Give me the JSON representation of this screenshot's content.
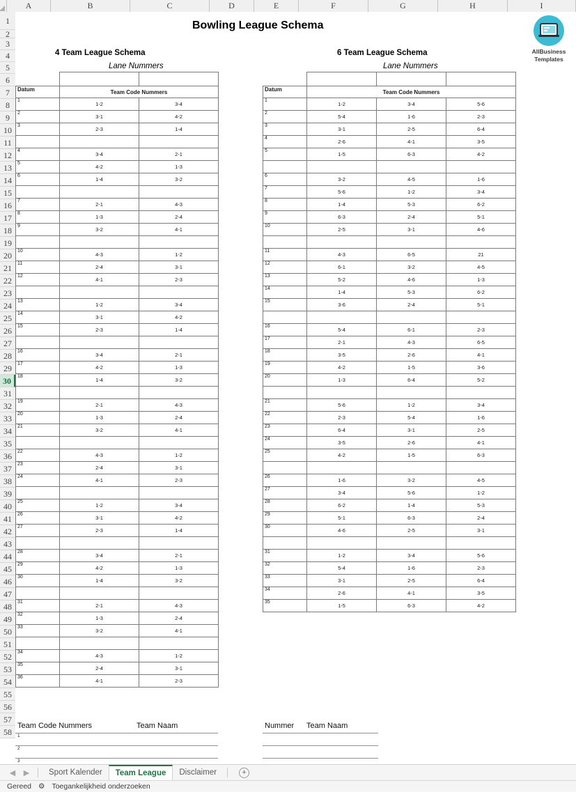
{
  "app": {
    "column_headers": [
      "A",
      "B",
      "C",
      "D",
      "E",
      "F",
      "G",
      "H",
      "I"
    ],
    "selected_cell_row": 30
  },
  "logo": {
    "name": "allbusiness-templates-logo",
    "line1": "AllBusiness",
    "line2": "Templates",
    "accent_color": "#3bbcd4",
    "icon": "laptop-icon"
  },
  "titles": {
    "document_title": "Bowling League Schema",
    "schema4_title": "4 Team League Schema",
    "schema6_title": "6 Team League Schema",
    "lane_label_left": "Lane Nummers",
    "lane_label_right": "Lane Nummers"
  },
  "headers": {
    "datum": "Datum",
    "team_code_nummers": "Team Code Nummers"
  },
  "schema4": {
    "rows": [
      {
        "datum": "1",
        "matches": [
          "1-2",
          "3-4"
        ]
      },
      {
        "datum": "2",
        "matches": [
          "3-1",
          "4-2"
        ]
      },
      {
        "datum": "3",
        "matches": [
          "2-3",
          "1-4"
        ]
      },
      {
        "datum": "",
        "matches": [
          "",
          ""
        ]
      },
      {
        "datum": "4",
        "matches": [
          "3-4",
          "2-1"
        ]
      },
      {
        "datum": "5",
        "matches": [
          "4-2",
          "1-3"
        ]
      },
      {
        "datum": "6",
        "matches": [
          "1-4",
          "3-2"
        ]
      },
      {
        "datum": "",
        "matches": [
          "",
          ""
        ]
      },
      {
        "datum": "7",
        "matches": [
          "2-1",
          "4-3"
        ]
      },
      {
        "datum": "8",
        "matches": [
          "1-3",
          "2-4"
        ]
      },
      {
        "datum": "9",
        "matches": [
          "3-2",
          "4-1"
        ]
      },
      {
        "datum": "",
        "matches": [
          "",
          ""
        ]
      },
      {
        "datum": "10",
        "matches": [
          "4-3",
          "1-2"
        ]
      },
      {
        "datum": "11",
        "matches": [
          "2-4",
          "3-1"
        ]
      },
      {
        "datum": "12",
        "matches": [
          "4-1",
          "2-3"
        ]
      },
      {
        "datum": "",
        "matches": [
          "",
          ""
        ]
      },
      {
        "datum": "13",
        "matches": [
          "1-2",
          "3-4"
        ]
      },
      {
        "datum": "14",
        "matches": [
          "3-1",
          "4-2"
        ]
      },
      {
        "datum": "15",
        "matches": [
          "2-3",
          "1-4"
        ]
      },
      {
        "datum": "",
        "matches": [
          "",
          ""
        ]
      },
      {
        "datum": "16",
        "matches": [
          "3-4",
          "2-1"
        ]
      },
      {
        "datum": "17",
        "matches": [
          "4-2",
          "1-3"
        ]
      },
      {
        "datum": "18",
        "matches": [
          "1-4",
          "3-2"
        ]
      },
      {
        "datum": "",
        "matches": [
          "",
          ""
        ]
      },
      {
        "datum": "19",
        "matches": [
          "2-1",
          "4-3"
        ]
      },
      {
        "datum": "20",
        "matches": [
          "1-3",
          "2-4"
        ]
      },
      {
        "datum": "21",
        "matches": [
          "3-2",
          "4-1"
        ]
      },
      {
        "datum": "",
        "matches": [
          "",
          ""
        ]
      },
      {
        "datum": "22",
        "matches": [
          "4-3",
          "1-2"
        ]
      },
      {
        "datum": "23",
        "matches": [
          "2-4",
          "3-1"
        ]
      },
      {
        "datum": "24",
        "matches": [
          "4-1",
          "2-3"
        ]
      },
      {
        "datum": "",
        "matches": [
          "",
          ""
        ]
      },
      {
        "datum": "25",
        "matches": [
          "1-2",
          "3-4"
        ]
      },
      {
        "datum": "26",
        "matches": [
          "3-1",
          "4-2"
        ]
      },
      {
        "datum": "27",
        "matches": [
          "2-3",
          "1-4"
        ]
      },
      {
        "datum": "",
        "matches": [
          "",
          ""
        ]
      },
      {
        "datum": "28",
        "matches": [
          "3-4",
          "2-1"
        ]
      },
      {
        "datum": "29",
        "matches": [
          "4-2",
          "1-3"
        ]
      },
      {
        "datum": "30",
        "matches": [
          "1-4",
          "3-2"
        ]
      },
      {
        "datum": "",
        "matches": [
          "",
          ""
        ]
      },
      {
        "datum": "31",
        "matches": [
          "2-1",
          "4-3"
        ]
      },
      {
        "datum": "32",
        "matches": [
          "1-3",
          "2-4"
        ]
      },
      {
        "datum": "33",
        "matches": [
          "3-2",
          "4-1"
        ]
      },
      {
        "datum": "",
        "matches": [
          "",
          ""
        ]
      },
      {
        "datum": "34",
        "matches": [
          "4-3",
          "1-2"
        ]
      },
      {
        "datum": "35",
        "matches": [
          "2-4",
          "3-1"
        ]
      },
      {
        "datum": "36",
        "matches": [
          "4-1",
          "2-3"
        ]
      }
    ]
  },
  "schema6": {
    "rows": [
      {
        "datum": "1",
        "matches": [
          "1-2",
          "3-4",
          "5-6"
        ]
      },
      {
        "datum": "2",
        "matches": [
          "5-4",
          "1-6",
          "2-3"
        ]
      },
      {
        "datum": "3",
        "matches": [
          "3-1",
          "2-5",
          "6-4"
        ]
      },
      {
        "datum": "4",
        "matches": [
          "2-6",
          "4-1",
          "3-5"
        ]
      },
      {
        "datum": "5",
        "matches": [
          "1-5",
          "6-3",
          "4-2"
        ]
      },
      {
        "datum": "",
        "matches": [
          "",
          "",
          ""
        ]
      },
      {
        "datum": "6",
        "matches": [
          "3-2",
          "4-5",
          "1-6"
        ]
      },
      {
        "datum": "7",
        "matches": [
          "5-6",
          "1-2",
          "3-4"
        ]
      },
      {
        "datum": "8",
        "matches": [
          "1-4",
          "5-3",
          "6-2"
        ]
      },
      {
        "datum": "9",
        "matches": [
          "6-3",
          "2-4",
          "5-1"
        ]
      },
      {
        "datum": "10",
        "matches": [
          "2-5",
          "3-1",
          "4-6"
        ]
      },
      {
        "datum": "",
        "matches": [
          "",
          "",
          ""
        ]
      },
      {
        "datum": "11",
        "matches": [
          "4-3",
          "6-5",
          "21"
        ]
      },
      {
        "datum": "12",
        "matches": [
          "6-1",
          "3-2",
          "4-5"
        ]
      },
      {
        "datum": "13",
        "matches": [
          "5-2",
          "4-6",
          "1-3"
        ]
      },
      {
        "datum": "14",
        "matches": [
          "1-4",
          "5-3",
          "6-2"
        ]
      },
      {
        "datum": "15",
        "matches": [
          "3-6",
          "2-4",
          "5-1"
        ]
      },
      {
        "datum": "",
        "matches": [
          "",
          "",
          ""
        ]
      },
      {
        "datum": "16",
        "matches": [
          "5-4",
          "6-1",
          "2-3"
        ]
      },
      {
        "datum": "17",
        "matches": [
          "2-1",
          "4-3",
          "6-5"
        ]
      },
      {
        "datum": "18",
        "matches": [
          "3-5",
          "2-6",
          "4-1"
        ]
      },
      {
        "datum": "19",
        "matches": [
          "4-2",
          "1-5",
          "3-6"
        ]
      },
      {
        "datum": "20",
        "matches": [
          "1-3",
          "6-4",
          "5-2"
        ]
      },
      {
        "datum": "",
        "matches": [
          "",
          "",
          ""
        ]
      },
      {
        "datum": "21",
        "matches": [
          "5-6",
          "1-2",
          "3-4"
        ]
      },
      {
        "datum": "22",
        "matches": [
          "2-3",
          "5-4",
          "1-6"
        ]
      },
      {
        "datum": "23",
        "matches": [
          "6-4",
          "3-1",
          "2-5"
        ]
      },
      {
        "datum": "24",
        "matches": [
          "3-5",
          "2-6",
          "4-1"
        ]
      },
      {
        "datum": "25",
        "matches": [
          "4-2",
          "1-5",
          "6-3"
        ]
      },
      {
        "datum": "",
        "matches": [
          "",
          "",
          ""
        ]
      },
      {
        "datum": "26",
        "matches": [
          "1-6",
          "3-2",
          "4-5"
        ]
      },
      {
        "datum": "27",
        "matches": [
          "3-4",
          "5-6",
          "1-2"
        ]
      },
      {
        "datum": "28",
        "matches": [
          "6-2",
          "1-4",
          "5-3"
        ]
      },
      {
        "datum": "29",
        "matches": [
          "5-1",
          "6-3",
          "2-4"
        ]
      },
      {
        "datum": "30",
        "matches": [
          "4-6",
          "2-5",
          "3-1"
        ]
      },
      {
        "datum": "",
        "matches": [
          "",
          "",
          ""
        ]
      },
      {
        "datum": "31",
        "matches": [
          "1-2",
          "3-4",
          "5-6"
        ]
      },
      {
        "datum": "32",
        "matches": [
          "5-4",
          "1-6",
          "2-3"
        ]
      },
      {
        "datum": "33",
        "matches": [
          "3-1",
          "2-5",
          "6-4"
        ]
      },
      {
        "datum": "34",
        "matches": [
          "2-6",
          "4-1",
          "3-5"
        ]
      },
      {
        "datum": "35",
        "matches": [
          "1-5",
          "6-3",
          "4-2"
        ]
      }
    ]
  },
  "legend_left": {
    "header_code": "Team Code Nummers",
    "header_name": "Team Naam",
    "numbers": [
      "1",
      "2",
      "3"
    ]
  },
  "legend_right": {
    "header_code": "Nummer",
    "header_name": "Team Naam",
    "numbers": [
      "",
      "",
      ""
    ]
  },
  "tabs": {
    "prev_icon": "chevron-left-icon",
    "next_icon": "chevron-right-icon",
    "items": [
      {
        "label": "Sport Kalender",
        "active": false
      },
      {
        "label": "Team League",
        "active": true
      },
      {
        "label": "Disclaimer",
        "active": false
      }
    ],
    "add_label": "+",
    "active_color": "#217346"
  },
  "statusbar": {
    "ready": "Gereed",
    "accessibility_icon": "accessibility-icon",
    "accessibility": "Toegankelijkheid onderzoeken"
  }
}
